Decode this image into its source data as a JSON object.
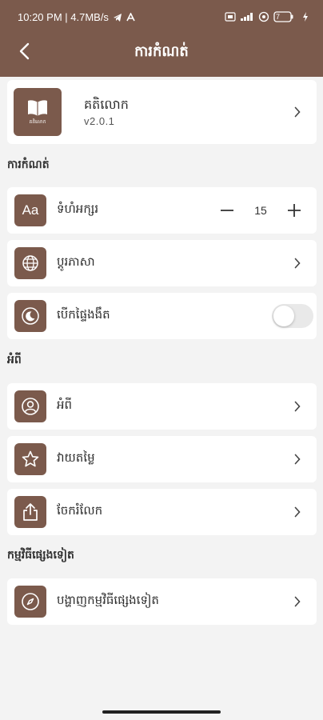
{
  "status_bar": {
    "left_text": "10:20 PM | 4.7MB/s",
    "battery": "7"
  },
  "header": {
    "title": "ការកំណត់"
  },
  "app_info": {
    "name": "គតិលោក",
    "version": "v2.0.1",
    "logo_caption": "គតិលោក"
  },
  "sections": {
    "settings_label": "ការកំណត់",
    "about_label": "អំពី",
    "more_apps_label": "កម្មវិធីផ្សេងទៀត"
  },
  "settings": {
    "font_size_label": "ទំហំអក្សរ",
    "font_size_value": "15",
    "language_label": "ប្តូរភាសា",
    "dark_mode_label": "បើកផ្ទៃងងឹត",
    "dark_mode_on": false
  },
  "about": {
    "about_label": "អំពី",
    "rate_label": "វាយតម្លៃ",
    "share_label": "ចែករំលែក"
  },
  "more": {
    "more_apps_label": "បង្ហាញកម្មវិធីផ្សេងទៀត"
  },
  "colors": {
    "brand": "#7b5a4c",
    "background": "#f3f3f3",
    "card": "#ffffff"
  },
  "icons": {
    "font_size": "font-size-icon",
    "language": "globe-icon",
    "dark_mode": "moon-icon",
    "about": "user-circle-icon",
    "rate": "star-icon",
    "share": "share-icon",
    "more_apps": "compass-icon"
  }
}
